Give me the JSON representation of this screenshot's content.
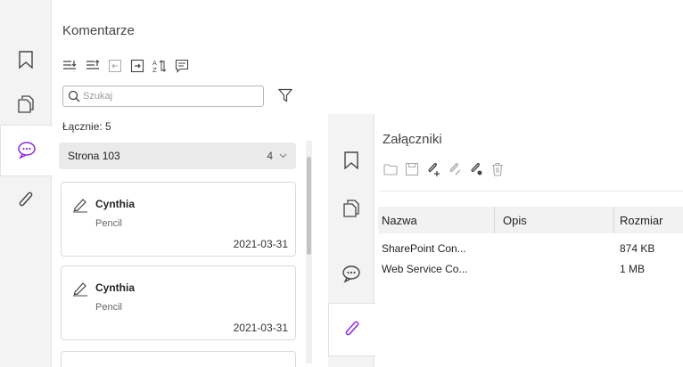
{
  "comments_panel": {
    "title": "Komentarze",
    "search_placeholder": "Szukaj",
    "total_label": "Łącznie: 5",
    "group": {
      "label": "Strona 103",
      "count": "4"
    },
    "cards": [
      {
        "author": "Cynthia",
        "type": "Pencil",
        "date": "2021-03-31"
      },
      {
        "author": "Cynthia",
        "type": "Pencil",
        "date": "2021-03-31"
      }
    ]
  },
  "attachments_panel": {
    "title": "Załączniki",
    "columns": {
      "name": "Nazwa",
      "description": "Opis",
      "size": "Rozmiar"
    },
    "rows": [
      {
        "name": "SharePoint Con...",
        "description": "",
        "size": "874 KB"
      },
      {
        "name": "Web Service Co...",
        "description": "",
        "size": "1 MB"
      }
    ]
  },
  "colors": {
    "accent": "#8a2be2",
    "rail_bg": "#f3f3f3",
    "icon": "#444444",
    "icon_disabled": "#a9a9a9"
  },
  "icons": [
    "bookmark-icon",
    "pages-icon",
    "comments-icon",
    "attachment-icon",
    "expand-all-icon",
    "collapse-all-icon",
    "import-icon",
    "export-icon",
    "sort-icon",
    "summary-icon",
    "search-icon",
    "filter-icon",
    "chevron-down-icon",
    "pencil-icon",
    "open-folder-icon",
    "save-icon",
    "add-attachment-icon",
    "edit-attachment-icon",
    "attachment-settings-icon",
    "delete-icon"
  ]
}
